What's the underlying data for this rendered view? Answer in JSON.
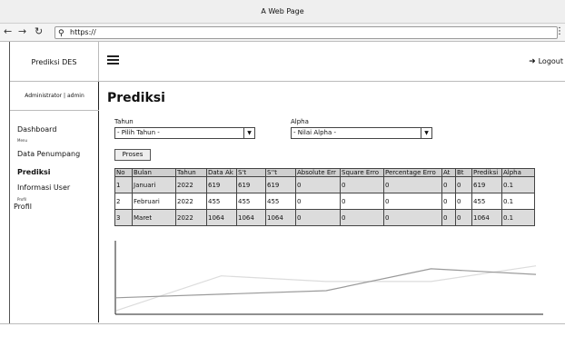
{
  "window": {
    "title": "A Web Page"
  },
  "browser": {
    "url": "https://",
    "back_icon": "arrow-left",
    "forward_icon": "arrow-right",
    "reload_icon": "reload",
    "search_icon": "search",
    "menu_icon": "more-vertical"
  },
  "header": {
    "brand": "Prediksi DES",
    "logout_label": "Logout"
  },
  "sidebar": {
    "user": "Administrator | admin",
    "items": [
      {
        "label": "Dashboard"
      },
      {
        "caption": "Menu"
      },
      {
        "label": "Data Penumpang"
      },
      {
        "label": "Prediksi"
      },
      {
        "label": "Informasi User"
      },
      {
        "caption": "Profil"
      },
      {
        "label": "Profil"
      }
    ]
  },
  "main": {
    "title": "Prediksi",
    "tahun": {
      "label": "Tahun :",
      "value": "- Pilih Tahun -"
    },
    "alpha": {
      "label": "Alpha",
      "value": "- Nilai Alpha -"
    },
    "proses_label": "Proses",
    "table": {
      "headers": [
        "No",
        "Bulan",
        "Tahun",
        "Data Ak",
        "S't",
        "S''t",
        "Absolute Err",
        "Square Erro",
        "Percentage Erro",
        "At",
        "Bt",
        "Prediksi",
        "Alpha"
      ],
      "rows": [
        [
          "1",
          "Januari",
          "2022",
          "619",
          "619",
          "619",
          "0",
          "0",
          "0",
          "0",
          "0",
          "619",
          "0.1"
        ],
        [
          "2",
          "Februari",
          "2022",
          "455",
          "455",
          "455",
          "0",
          "0",
          "0",
          "0",
          "0",
          "455",
          "0.1"
        ],
        [
          "3",
          "Maret",
          "2022",
          "1064",
          "1064",
          "1064",
          "0",
          "0",
          "0",
          "0",
          "0",
          "1064",
          "0.1"
        ]
      ]
    }
  },
  "chart_data": {
    "type": "line",
    "title": "",
    "xlabel": "",
    "ylabel": "",
    "grid": false,
    "ylim": [
      0,
      100
    ],
    "x": [
      0,
      1,
      2,
      3,
      4
    ],
    "series": [
      {
        "color": "#9a9a9a",
        "values": [
          22,
          27,
          32,
          63,
          55
        ]
      },
      {
        "color": "#dcdcdc",
        "values": [
          4,
          53,
          45,
          45,
          67
        ]
      }
    ]
  }
}
